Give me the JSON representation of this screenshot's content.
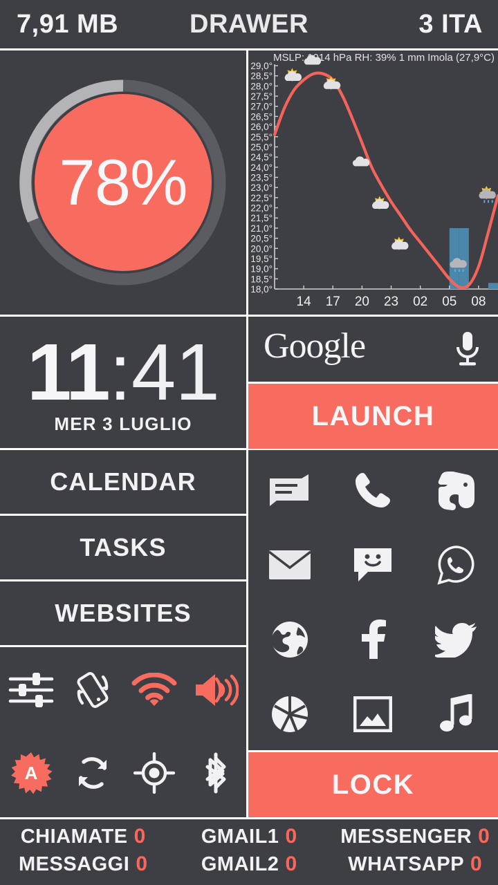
{
  "statusbar": {
    "memory": "7,91 MB",
    "title": "DRAWER",
    "right": "3 ITA"
  },
  "battery": {
    "percent_label": "78%",
    "percent_value": 78,
    "fill_color": "#f86c60",
    "track_color": "#5b5b62",
    "progress_color": "#b4b4b8"
  },
  "weather": {
    "header_left": "MSLP: 1014 hPa  RH: 39%  1 mm",
    "header_right": "Imola (27,9°C)",
    "chart_data": {
      "type": "line",
      "title": "Imola (27,9°C)",
      "subtitle": "MSLP: 1014 hPa  RH: 39%  1 mm",
      "xlabel": "",
      "ylabel": "",
      "grid": false,
      "legend": "none",
      "ylim": [
        18.0,
        29.0
      ],
      "ytick_labels": [
        "29,0°",
        "28,5°",
        "28,0°",
        "27,5°",
        "27,0°",
        "26,5°",
        "26,0°",
        "25,5°",
        "25,0°",
        "24,5°",
        "24,0°",
        "23,5°",
        "23,0°",
        "22,5°",
        "22,0°",
        "21,5°",
        "21,0°",
        "20,5°",
        "20,0°",
        "19,5°",
        "19,0°",
        "18,5°",
        "18,0°"
      ],
      "xtick_labels": [
        "14",
        "17",
        "20",
        "23",
        "02",
        "05",
        "08"
      ],
      "series": [
        {
          "name": "Temperature",
          "color": "#f4645a",
          "x": [
            11,
            12,
            13,
            14,
            15,
            16,
            17,
            18,
            19,
            20,
            21,
            22,
            23,
            0,
            1,
            2,
            3,
            4,
            5,
            6,
            7,
            8,
            9,
            10
          ],
          "values": [
            25.6,
            26.9,
            27.8,
            28.3,
            28.6,
            28.6,
            28.3,
            27.5,
            26.4,
            25.2,
            24.0,
            23.1,
            22.3,
            21.6,
            20.9,
            20.3,
            19.7,
            19.1,
            18.5,
            18.1,
            18.2,
            19.1,
            20.8,
            22.6
          ]
        }
      ],
      "precipitation_bars": {
        "name": "Precipitation",
        "color": "#4b87ab",
        "x": [
          5,
          6,
          9,
          10
        ],
        "heights_deg": [
          21.0,
          21.0,
          18.3,
          18.3
        ]
      },
      "condition_icons": [
        {
          "x": 13,
          "temp": 27.9,
          "icon": "sun-cloud"
        },
        {
          "x": 15,
          "temp": 28.7,
          "icon": "cloud"
        },
        {
          "x": 17,
          "temp": 27.5,
          "icon": "sun-cloud"
        },
        {
          "x": 20,
          "temp": 23.7,
          "icon": "cloud"
        },
        {
          "x": 22,
          "temp": 21.6,
          "icon": "sun-cloud"
        },
        {
          "x": 0,
          "temp": 19.6,
          "icon": "sun-cloud"
        },
        {
          "x": 6,
          "temp": 18.7,
          "icon": "rain-cloud"
        },
        {
          "x": 9,
          "temp": 22.1,
          "icon": "sun-rain-cloud"
        }
      ]
    }
  },
  "clock": {
    "hours": "11",
    "separator": ":",
    "minutes": "41",
    "date": "MER 3 LUGLIO"
  },
  "search": {
    "logo": "Google",
    "mic_icon": "microphone-icon"
  },
  "buttons": {
    "launch": "LAUNCH",
    "lock": "LOCK",
    "accent_color": "#f86c60"
  },
  "menu": {
    "items": [
      {
        "label": "CALENDAR"
      },
      {
        "label": "TASKS"
      },
      {
        "label": "WEBSITES"
      }
    ]
  },
  "toggles": {
    "active_color": "#f86c60",
    "inactive_color": "#f2f2f4",
    "items": [
      {
        "name": "settings-sliders-icon",
        "label": "Settings",
        "active": false
      },
      {
        "name": "auto-rotate-icon",
        "label": "Auto rotate",
        "active": false
      },
      {
        "name": "wifi-icon",
        "label": "Wi-Fi",
        "active": true
      },
      {
        "name": "volume-icon",
        "label": "Volume",
        "active": true
      },
      {
        "name": "auto-brightness-icon",
        "label": "Auto brightness",
        "active": true
      },
      {
        "name": "sync-icon",
        "label": "Sync",
        "active": false
      },
      {
        "name": "gps-location-icon",
        "label": "GPS",
        "active": false
      },
      {
        "name": "bluetooth-icon",
        "label": "Bluetooth",
        "active": false
      }
    ]
  },
  "apps": {
    "items": [
      {
        "name": "news-icon",
        "label": "News"
      },
      {
        "name": "phone-icon",
        "label": "Phone"
      },
      {
        "name": "evernote-icon",
        "label": "Evernote"
      },
      {
        "name": "email-icon",
        "label": "Email"
      },
      {
        "name": "messaging-icon",
        "label": "Messaging"
      },
      {
        "name": "whatsapp-icon",
        "label": "WhatsApp"
      },
      {
        "name": "browser-icon",
        "label": "Browser"
      },
      {
        "name": "facebook-icon",
        "label": "Facebook"
      },
      {
        "name": "twitter-icon",
        "label": "Twitter"
      },
      {
        "name": "camera-icon",
        "label": "Camera"
      },
      {
        "name": "gallery-icon",
        "label": "Gallery"
      },
      {
        "name": "music-icon",
        "label": "Music"
      }
    ]
  },
  "counters": {
    "value_color": "#f8675a",
    "items": [
      {
        "label": "CHIAMATE",
        "value": "0"
      },
      {
        "label": "GMAIL1",
        "value": "0"
      },
      {
        "label": "MESSENGER",
        "value": "0"
      },
      {
        "label": "MESSAGGI",
        "value": "0"
      },
      {
        "label": "GMAIL2",
        "value": "0"
      },
      {
        "label": "WHATSAPP",
        "value": "0"
      }
    ]
  }
}
